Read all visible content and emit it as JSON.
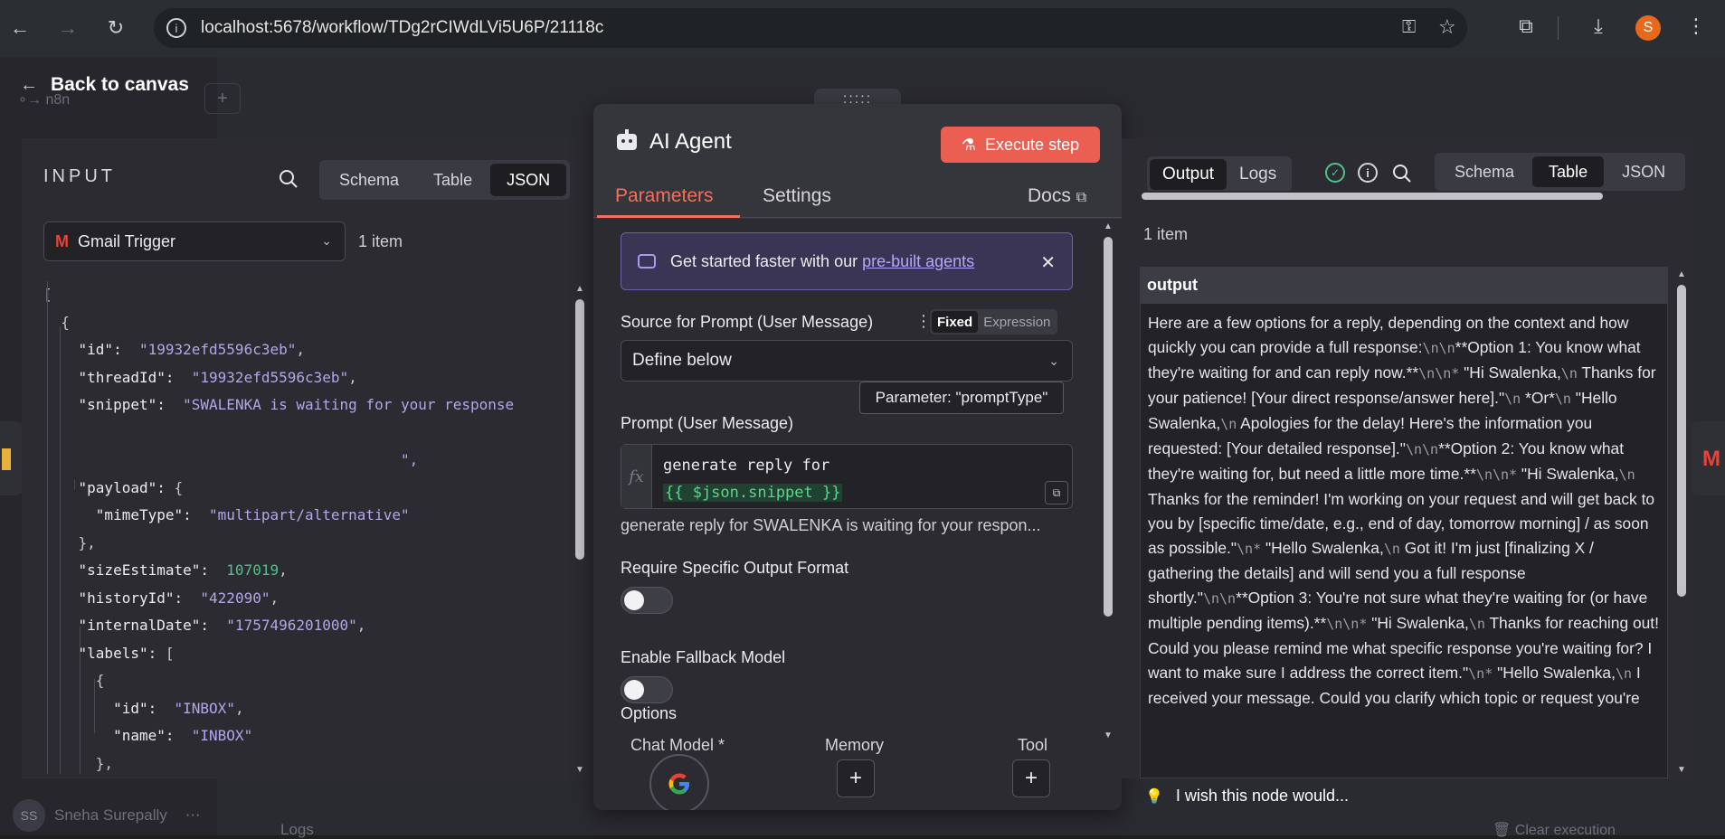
{
  "browser": {
    "url": "localhost:5678/workflow/TDg2rCIWdLVi5U6P/21118c",
    "avatar_letter": "S"
  },
  "background": {
    "back_label": "Back to canvas",
    "logo_text": "n8n",
    "user_initials": "SS",
    "user_name": "Sneha Surepally",
    "logs_label": "Logs",
    "clear_label": "Clear execution"
  },
  "input": {
    "title": "INPUT",
    "views": [
      "Schema",
      "Table",
      "JSON"
    ],
    "active_view": "JSON",
    "node": "Gmail Trigger",
    "item_count": "1 item",
    "json": {
      "id": "\"19932efd5596c3eb\"",
      "threadId": "\"19932efd5596c3eb\"",
      "snippet": "\"SWALENKA is waiting for your response",
      "snippet_end": "\",",
      "mimeType": "\"multipart/alternative\"",
      "sizeEstimate": "107019",
      "historyId": "\"422090\"",
      "internalDate": "\"1757496201000\"",
      "label_id": "\"INBOX\"",
      "label_name": "\"INBOX\""
    }
  },
  "modal": {
    "title": "AI Agent",
    "execute_label": "Execute step",
    "tabs": [
      "Parameters",
      "Settings"
    ],
    "docs_label": "Docs",
    "banner_text": "Get started faster with our ",
    "banner_link": "pre-built agents",
    "source_label": "Source for Prompt (User Message)",
    "mode_fixed": "Fixed",
    "mode_expression": "Expression",
    "source_value": "Define below",
    "tooltip": "Parameter: \"promptType\"",
    "prompt_label": "Prompt (User Message)",
    "prompt_line1": "generate reply for",
    "prompt_expr": "{{ $json.snippet }}",
    "prompt_preview": "generate reply for SWALENKA is waiting for your respon...",
    "require_format_label": "Require Specific Output Format",
    "require_format_on": false,
    "fallback_label": "Enable Fallback Model",
    "fallback_on": false,
    "options_label": "Options",
    "chat_model_label": "Chat Model *",
    "memory_label": "Memory",
    "tool_label": "Tool"
  },
  "output": {
    "tabs": [
      "Output",
      "Logs"
    ],
    "active_tab": "Output",
    "views": [
      "Schema",
      "Table",
      "JSON"
    ],
    "active_view": "Table",
    "item_count": "1 item",
    "column": "output",
    "cell_parts": [
      [
        "t",
        "Here are a few options for a reply, depending on the context and how quickly you can provide a full response:"
      ],
      [
        "e",
        "\\n\\n"
      ],
      [
        "t",
        "**Option 1: You know what they're waiting for and can reply now.**"
      ],
      [
        "e",
        "\\n\\n*"
      ],
      [
        "t",
        "   \"Hi Swalenka,"
      ],
      [
        "e",
        "\\n"
      ],
      [
        "t",
        "    Thanks for your patience! [Your direct response/answer here].\""
      ],
      [
        "e",
        "\\n"
      ],
      [
        "t",
        "    *Or*"
      ],
      [
        "e",
        "\\n"
      ],
      [
        "t",
        "    \"Hello Swalenka,"
      ],
      [
        "e",
        "\\n"
      ],
      [
        "t",
        "    Apologies for the delay! Here's the information you requested: [Your detailed response].\""
      ],
      [
        "e",
        "\\n\\n"
      ],
      [
        "t",
        "**Option 2: You know what they're waiting for, but need a little more time.**"
      ],
      [
        "e",
        "\\n\\n*"
      ],
      [
        "t",
        "   \"Hi Swalenka,"
      ],
      [
        "e",
        "\\n"
      ],
      [
        "t",
        "    Thanks for the reminder! I'm working on your request and will get back to you by [specific time/date, e.g., end of day, tomorrow morning] / as soon as possible.\""
      ],
      [
        "e",
        "\\n*"
      ],
      [
        "t",
        "   \"Hello Swalenka,"
      ],
      [
        "e",
        "\\n"
      ],
      [
        "t",
        "    Got it! I'm just [finalizing X / gathering the details] and will send you a full response shortly.\""
      ],
      [
        "e",
        "\\n\\n"
      ],
      [
        "t",
        "**Option 3: You're not sure what they're waiting for (or have multiple pending items).**"
      ],
      [
        "e",
        "\\n\\n*"
      ],
      [
        "t",
        "   \"Hi Swalenka,"
      ],
      [
        "e",
        "\\n"
      ],
      [
        "t",
        " Thanks for reaching out! Could you please remind me what specific response you're waiting for? I want to make sure I address the correct item.\""
      ],
      [
        "e",
        "\\n*"
      ],
      [
        "t",
        "   \"Hello Swalenka,"
      ],
      [
        "e",
        "\\n"
      ],
      [
        "t",
        "    I received your message. Could you clarify which topic or request you're"
      ]
    ],
    "feedback_label": "I wish this node would..."
  }
}
